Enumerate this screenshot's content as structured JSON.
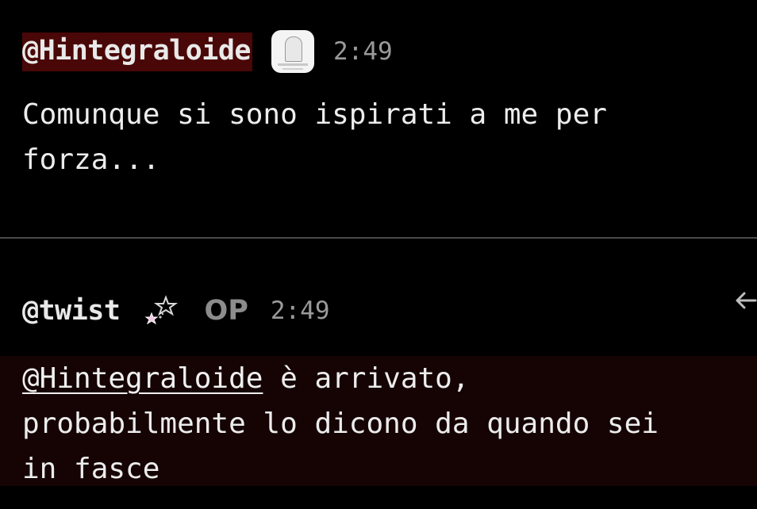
{
  "posts": [
    {
      "username": "@Hintegraloide",
      "avatar_icon": "ghost-avatar-icon",
      "time": "2:49",
      "text": "Comunque si sono ispirati a me per\nforza..."
    },
    {
      "username": "@twist",
      "flair_icon": "stars-icon",
      "badge": "OP",
      "time": "2:49",
      "mention": "@Hintegraloide",
      "text_rest": " è arrivato,\nprobabilmente lo dicono da quando sei\nin fasce",
      "reply_icon": "reply-arrow-icon"
    }
  ],
  "colors": {
    "background": "#000000",
    "highlight": "#4a0707",
    "reply_background": "#160405",
    "divider": "#4a4a4a",
    "muted": "#9a9a9a"
  }
}
